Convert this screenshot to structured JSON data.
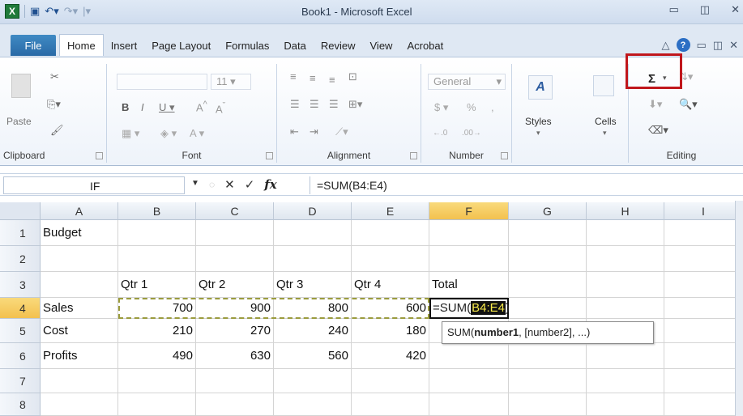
{
  "window": {
    "title": "Book1  -  Microsoft Excel"
  },
  "tabs": [
    "File",
    "Home",
    "Insert",
    "Page Layout",
    "Formulas",
    "Data",
    "Review",
    "View",
    "Acrobat"
  ],
  "ribbon": {
    "clipboard_label": "Clipboard",
    "paste_label": "Paste",
    "font_label": "Font",
    "font_size": "11",
    "alignment_label": "Alignment",
    "number_label": "Number",
    "number_format": "General",
    "styles_label": "Styles",
    "cells_label": "Cells",
    "editing_label": "Editing",
    "autosum_symbol": "Σ"
  },
  "formula_bar": {
    "name_box": "IF",
    "fx": "fx",
    "formula": "=SUM(B4:E4)"
  },
  "grid": {
    "columns": [
      "A",
      "B",
      "C",
      "D",
      "E",
      "F",
      "G",
      "H",
      "I"
    ],
    "rows": [
      "1",
      "2",
      "3",
      "4",
      "5",
      "6",
      "7",
      "8"
    ],
    "cells": {
      "A1": "Budget",
      "B3": "Qtr 1",
      "C3": "Qtr 2",
      "D3": "Qtr 3",
      "E3": "Qtr 4",
      "F3": "Total",
      "A4": "Sales",
      "B4": "700",
      "C4": "900",
      "D4": "800",
      "E4": "600",
      "A5": "Cost",
      "B5": "210",
      "C5": "270",
      "D5": "240",
      "E5": "180",
      "A6": "Profits",
      "B6": "490",
      "C6": "630",
      "D6": "560",
      "E6": "420"
    },
    "edit_cell": {
      "prefix": "=SUM(",
      "ref": "B4:E4",
      "suffix": ")"
    },
    "tooltip": {
      "func": "SUM(",
      "arg1": "number1",
      "rest": ", [number2], ...)"
    }
  }
}
